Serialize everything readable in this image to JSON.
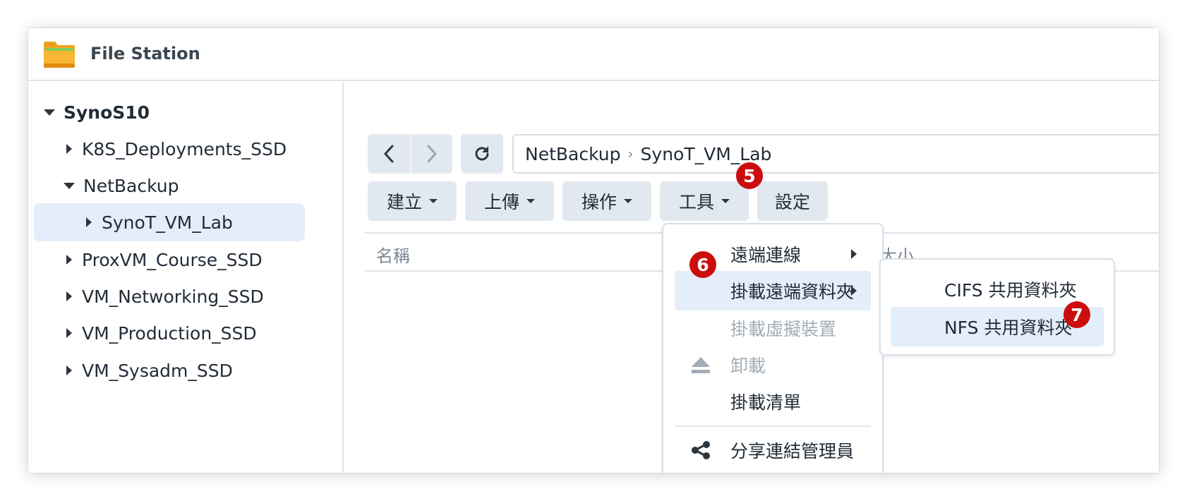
{
  "app": {
    "title": "File Station",
    "icon": "folder-icon"
  },
  "sidebar": {
    "root": "SynoS10",
    "items": [
      {
        "label": "K8S_Deployments_SSD",
        "expanded": false
      },
      {
        "label": "NetBackup",
        "expanded": true
      },
      {
        "label": "SynoT_VM_Lab",
        "expanded": false,
        "selected": true
      },
      {
        "label": "ProxVM_Course_SSD",
        "expanded": false
      },
      {
        "label": "VM_Networking_SSD",
        "expanded": false
      },
      {
        "label": "VM_Production_SSD",
        "expanded": false
      },
      {
        "label": "VM_Sysadm_SSD",
        "expanded": false
      }
    ]
  },
  "path": {
    "segments": [
      "NetBackup",
      "SynoT_VM_Lab"
    ],
    "separator": "›"
  },
  "toolbar": {
    "create": "建立",
    "upload": "上傳",
    "action": "操作",
    "tools": "工具",
    "settings": "設定"
  },
  "columns": {
    "name": "名稱",
    "size": "大小"
  },
  "tools_menu": {
    "remote_connection": "遠端連線",
    "mount_remote_folder": "掛載遠端資料夾",
    "mount_virtual_drive": "掛載虛擬裝置",
    "unmount": "卸載",
    "mount_list": "掛載清單",
    "share_link_manager": "分享連結管理員"
  },
  "submenu": {
    "cifs": "CIFS 共用資料夾",
    "nfs": "NFS 共用資料夾"
  },
  "badges": {
    "step5": "5",
    "step6": "6",
    "step7": "7"
  },
  "colors": {
    "badge": "#cc0d0d",
    "selection": "#e3eefa",
    "button": "#e2e8ef"
  }
}
